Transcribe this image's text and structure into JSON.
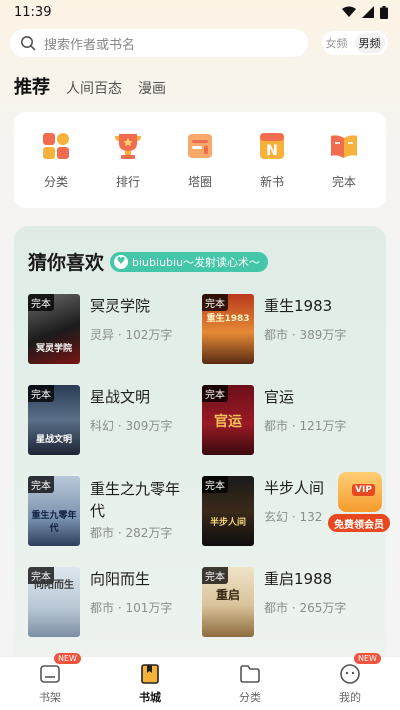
{
  "status_bar": {
    "time": "11:39"
  },
  "search": {
    "placeholder": "搜索作者或书名",
    "female_label": "女频",
    "male_label": "男频"
  },
  "tabs": [
    {
      "label": "推荐"
    },
    {
      "label": "人间百态"
    },
    {
      "label": "漫画"
    }
  ],
  "categories": [
    {
      "label": "分类",
      "icon": "grid-icon"
    },
    {
      "label": "排行",
      "icon": "trophy-icon"
    },
    {
      "label": "塔圈",
      "icon": "card-icon"
    },
    {
      "label": "新书",
      "icon": "new-book-icon"
    },
    {
      "label": "完本",
      "icon": "open-book-icon"
    }
  ],
  "guess": {
    "title": "猜你喜欢",
    "tag": "biubiubiu～发射读心术～",
    "badge": "完本",
    "books": [
      {
        "title": "冥灵学院",
        "meta": "灵异 · 102万字",
        "cover_text": "冥灵学院"
      },
      {
        "title": "重生1983",
        "meta": "都市 · 389万字",
        "cover_text": "重生1983"
      },
      {
        "title": "星战文明",
        "meta": "科幻 · 309万字",
        "cover_text": "星战文明"
      },
      {
        "title": "官运",
        "meta": "都市 · 121万字",
        "cover_text": "官运"
      },
      {
        "title": "重生之九零年代",
        "meta": "都市 · 282万字",
        "cover_text": "重生九零年代"
      },
      {
        "title": "半步人间",
        "meta": "玄幻 · 132",
        "cover_text": "半步人间"
      },
      {
        "title": "向阳而生",
        "meta": "都市 · 101万字",
        "cover_text": "向阳而生"
      },
      {
        "title": "重启1988",
        "meta": "都市 · 265万字",
        "cover_text": "重启"
      }
    ]
  },
  "vip_float": {
    "label": "免费领会员",
    "tag": "VIP"
  },
  "bottom_nav": [
    {
      "label": "书架",
      "badge": "NEW"
    },
    {
      "label": "书城",
      "badge": ""
    },
    {
      "label": "分类",
      "badge": ""
    },
    {
      "label": "我的",
      "badge": "NEW"
    }
  ]
}
